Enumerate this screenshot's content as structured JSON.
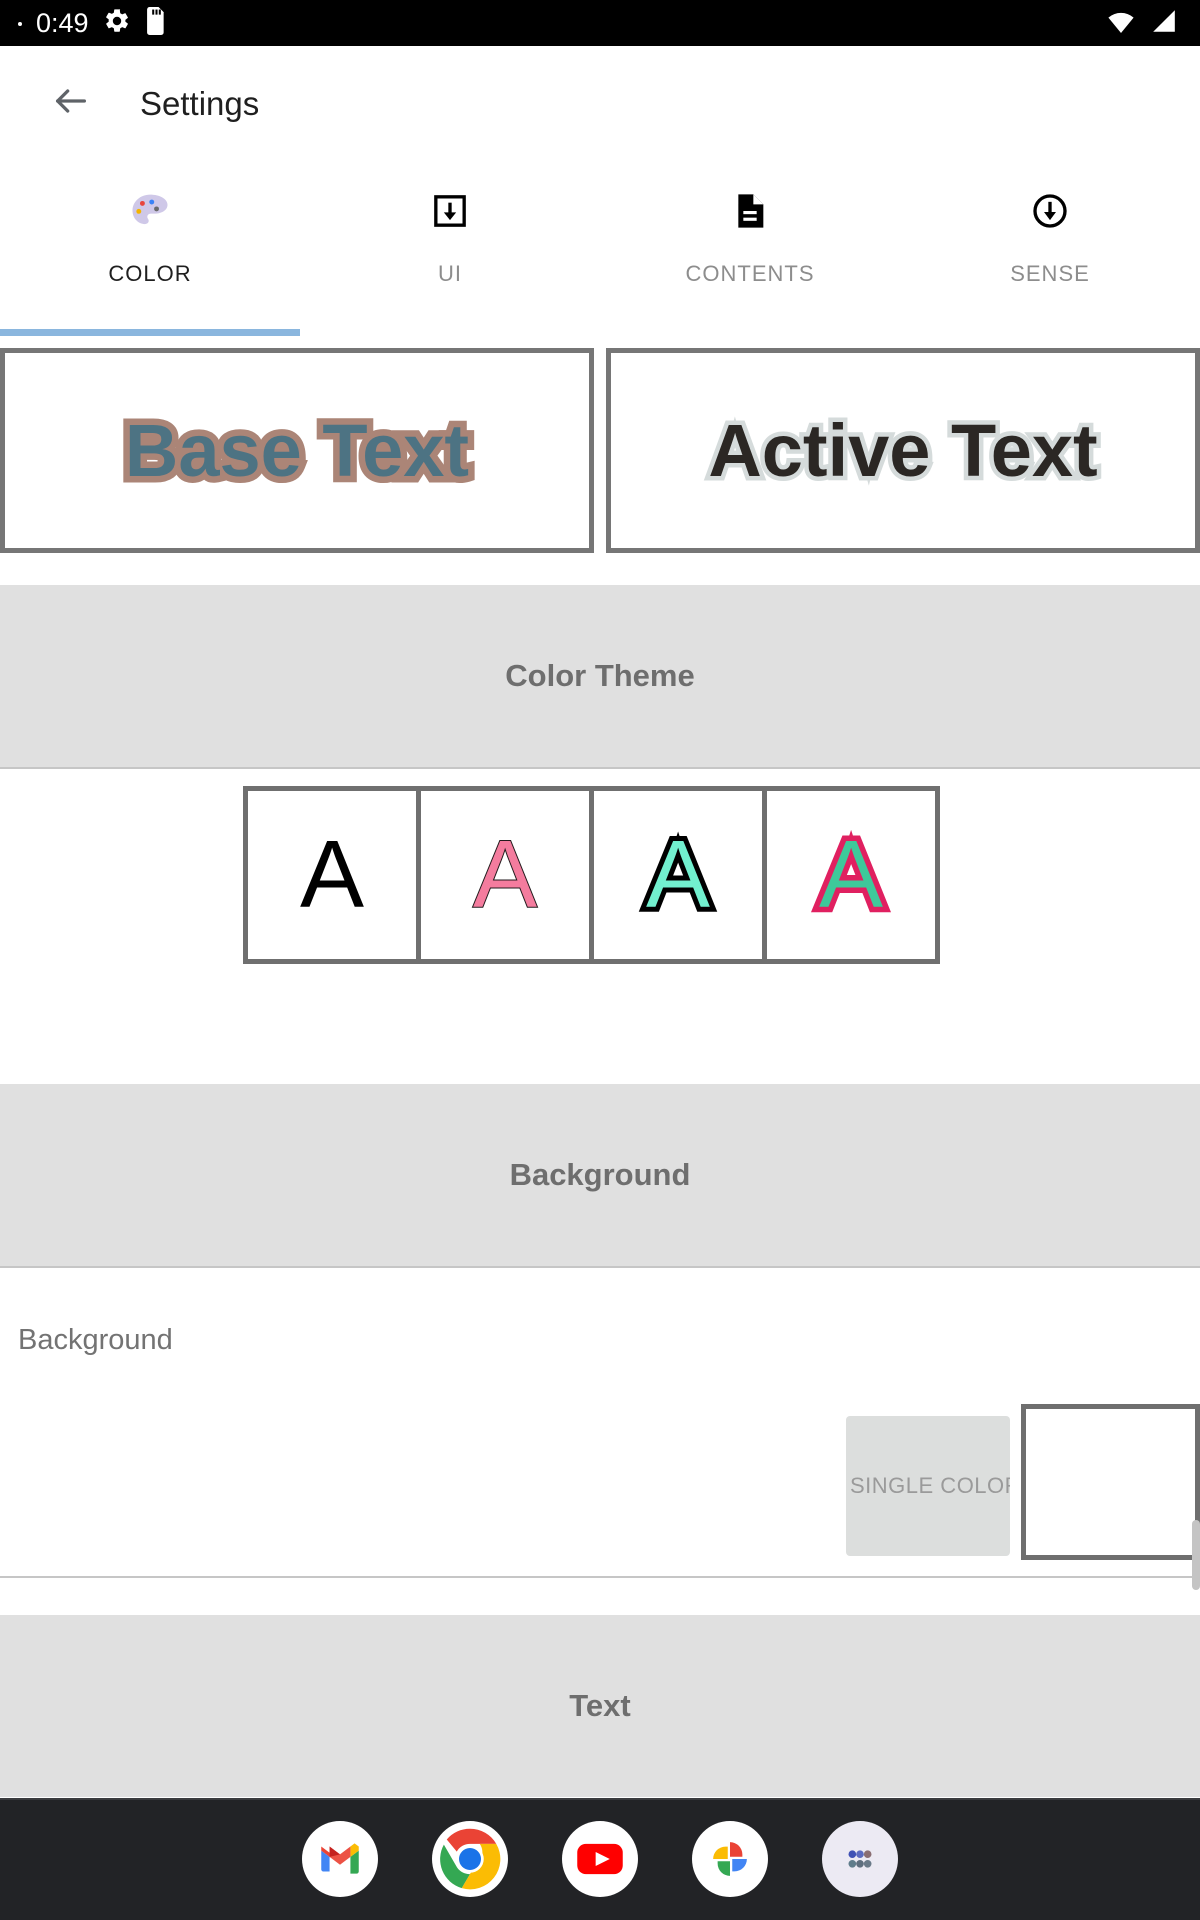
{
  "statusbar": {
    "clock": "0:49",
    "left_icons": [
      "dot-indicator",
      "android-gear-icon",
      "sd-card-icon"
    ],
    "right_icons": [
      "wifi-icon",
      "cell-signal-icon"
    ]
  },
  "appbar": {
    "back_icon": "back-arrow-icon",
    "title": "Settings"
  },
  "tabs": {
    "items": [
      {
        "label": "COLOR",
        "icon": "palette-icon",
        "active": true
      },
      {
        "label": "UI",
        "icon": "download-box-icon",
        "active": false
      },
      {
        "label": "CONTENTS",
        "icon": "document-icon",
        "active": false
      },
      {
        "label": "SENSE",
        "icon": "circle-down-arrow-icon",
        "active": false
      }
    ],
    "indicator_color": "#8ab6de"
  },
  "preview": {
    "base": {
      "text": "Base Text",
      "fill_color": "#4d7383",
      "outline_color": "#ab8577"
    },
    "active": {
      "text": "Active Text",
      "fill_color": "#2b2724",
      "outline_color": "#d5dbdb"
    }
  },
  "sections": {
    "color_theme": {
      "title": "Color Theme"
    },
    "background": {
      "title": "Background"
    },
    "text": {
      "title": "Text"
    }
  },
  "color_theme": {
    "swatches": [
      {
        "letter": "A",
        "fill_color": "#000000",
        "outline_color": "none",
        "selected": false
      },
      {
        "letter": "A",
        "fill_color": "#f47c9e",
        "outline_color": "#221a1c",
        "selected": false
      },
      {
        "letter": "A",
        "fill_color": "#72f0cf",
        "outline_color": "#000000",
        "selected": false
      },
      {
        "letter": "A",
        "fill_color": "#3ec99a",
        "outline_color": "#e02060",
        "selected": false
      }
    ]
  },
  "background_pref": {
    "label": "Background",
    "mode_button": "SINGLE COLOR",
    "swatch_color": "#ffffff"
  },
  "dock": {
    "apps": [
      {
        "name": "gmail-icon"
      },
      {
        "name": "chrome-icon"
      },
      {
        "name": "youtube-icon"
      },
      {
        "name": "google-photos-icon"
      },
      {
        "name": "app-drawer-icon"
      }
    ]
  }
}
